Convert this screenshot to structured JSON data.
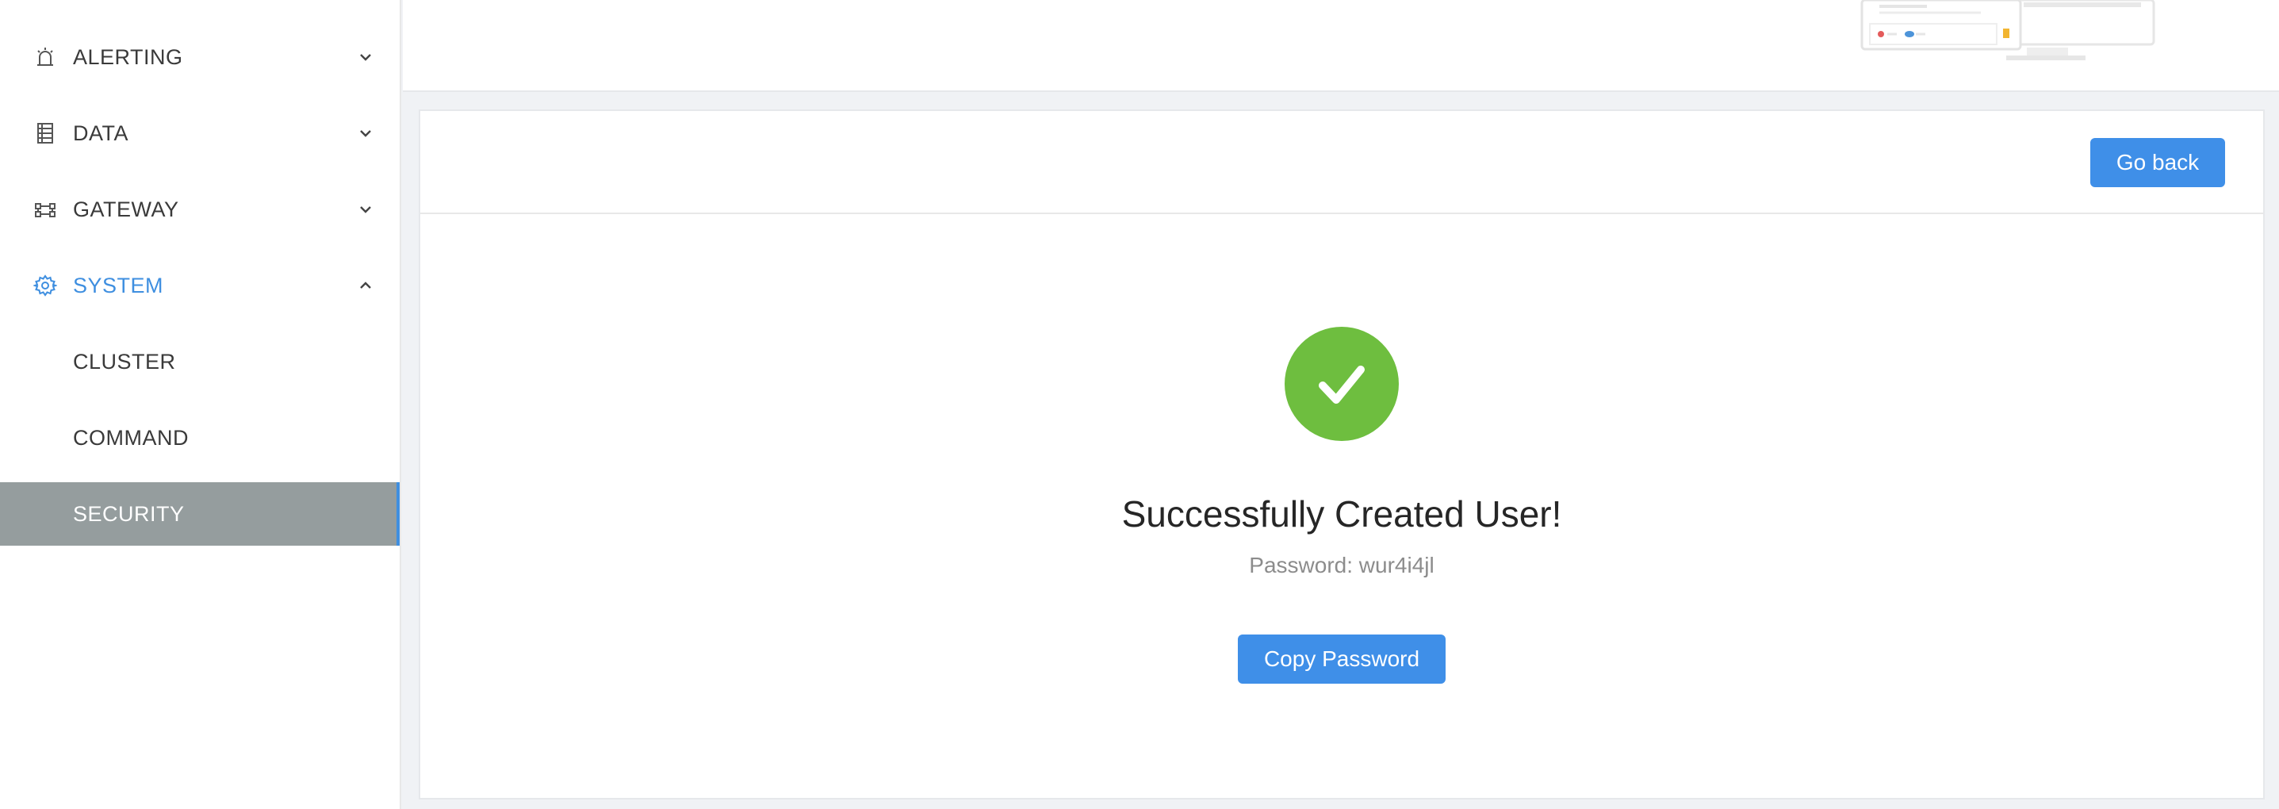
{
  "sidebar": {
    "items": [
      {
        "label": "ALERTING",
        "icon": "alarm-icon",
        "expanded": false
      },
      {
        "label": "DATA",
        "icon": "database-icon",
        "expanded": false
      },
      {
        "label": "GATEWAY",
        "icon": "gateway-icon",
        "expanded": false
      },
      {
        "label": "SYSTEM",
        "icon": "gear-icon",
        "expanded": true
      }
    ],
    "system_children": [
      {
        "label": "CLUSTER",
        "active": false
      },
      {
        "label": "COMMAND",
        "active": false
      },
      {
        "label": "SECURITY",
        "active": true
      }
    ]
  },
  "card": {
    "go_back_label": "Go back",
    "result": {
      "icon": "check-circle-icon",
      "title": "Successfully Created User!",
      "password_label": "Password:",
      "password_value": "wur4i4jl",
      "password_text": "Password: wur4i4jl",
      "copy_label": "Copy Password"
    }
  },
  "colors": {
    "accent": "#3f8fe8",
    "success": "#6ebe3f",
    "active_menu_bg": "#959d9e",
    "page_bg": "#f0f2f5"
  }
}
